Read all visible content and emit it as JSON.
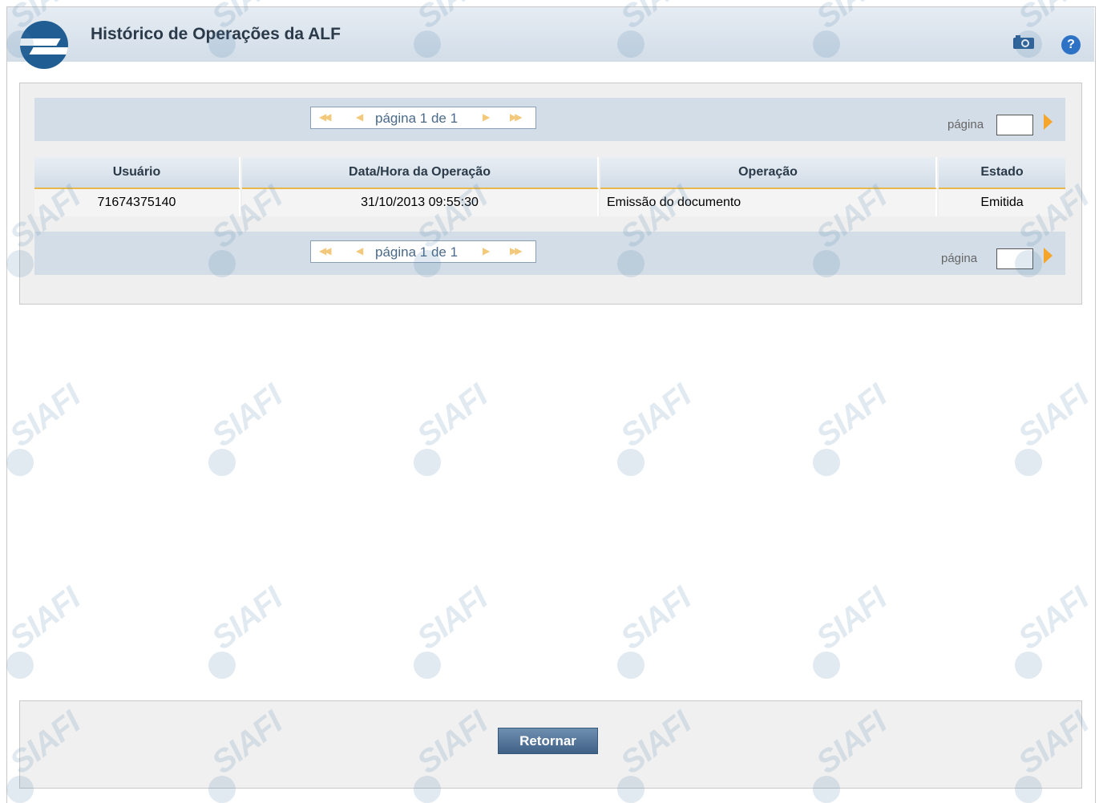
{
  "header": {
    "title": "Histórico de Operações da ALF",
    "icons": [
      "camera-icon",
      "help-icon"
    ]
  },
  "pager": {
    "text": "página 1 de 1",
    "goto_label": "página",
    "goto_value": "",
    "buttons": [
      "first-page-icon",
      "prev-page-icon",
      "next-page-icon",
      "last-page-icon"
    ]
  },
  "table": {
    "columns": [
      "Usuário",
      "Data/Hora da Operação",
      "Operação",
      "Estado"
    ],
    "rows": [
      [
        "71674375140",
        "31/10/2013 09:55:30",
        "Emissão do documento",
        "Emitida"
      ]
    ]
  },
  "footer": {
    "return_label": "Retornar"
  },
  "watermark": "SIAFI",
  "colors": {
    "accent_arrow": "#f5a52a",
    "header_bg": "#d2dde8",
    "button_bg": "#4f6f93",
    "help_icon": "#2d72c4"
  }
}
